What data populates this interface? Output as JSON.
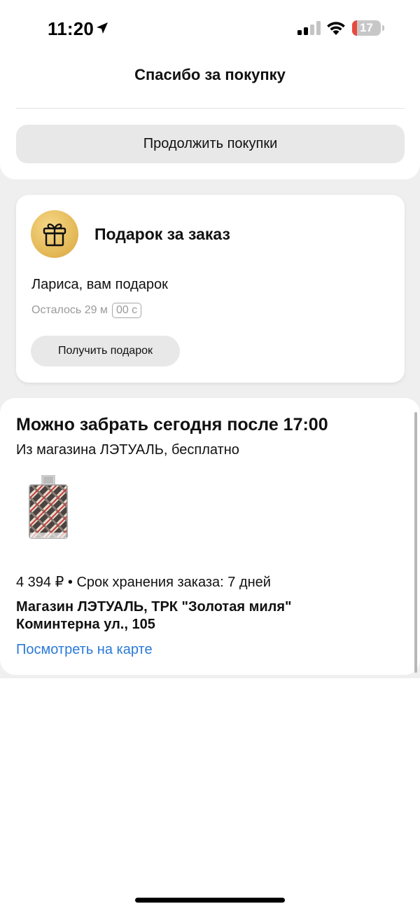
{
  "status_bar": {
    "time": "11:20",
    "battery_level": "17",
    "battery_fraction": 0.17,
    "signal_bars_active": 2,
    "signal_bars_total": 4,
    "icons": [
      "location-arrow-icon",
      "signal-icon",
      "wifi-icon",
      "battery-icon"
    ]
  },
  "header": {
    "title": "Спасибо за покупку",
    "continue_button": "Продолжить покупки"
  },
  "gift_card": {
    "icon": "gift-icon",
    "title": "Подарок за заказ",
    "greeting": "Лариса, вам подарок",
    "timer_prefix": "Осталось 29 м",
    "timer_seconds": "00 с",
    "button": "Получить подарок",
    "accent_color": "#e2b552"
  },
  "pickup": {
    "title": "Можно забрать сегодня после 17:00",
    "subtitle": "Из магазина ЛЭТУАЛЬ, бесплатно",
    "product_image": "perfume-bottle-image",
    "price_line": "4 394 ₽ • Срок хранения заказа: 7 дней",
    "store_name": "Магазин ЛЭТУАЛЬ, ТРК \"Золотая миля\"",
    "address": "Коминтерна ул., 105",
    "map_link": "Посмотреть на карте",
    "link_color": "#2a7ad8"
  }
}
